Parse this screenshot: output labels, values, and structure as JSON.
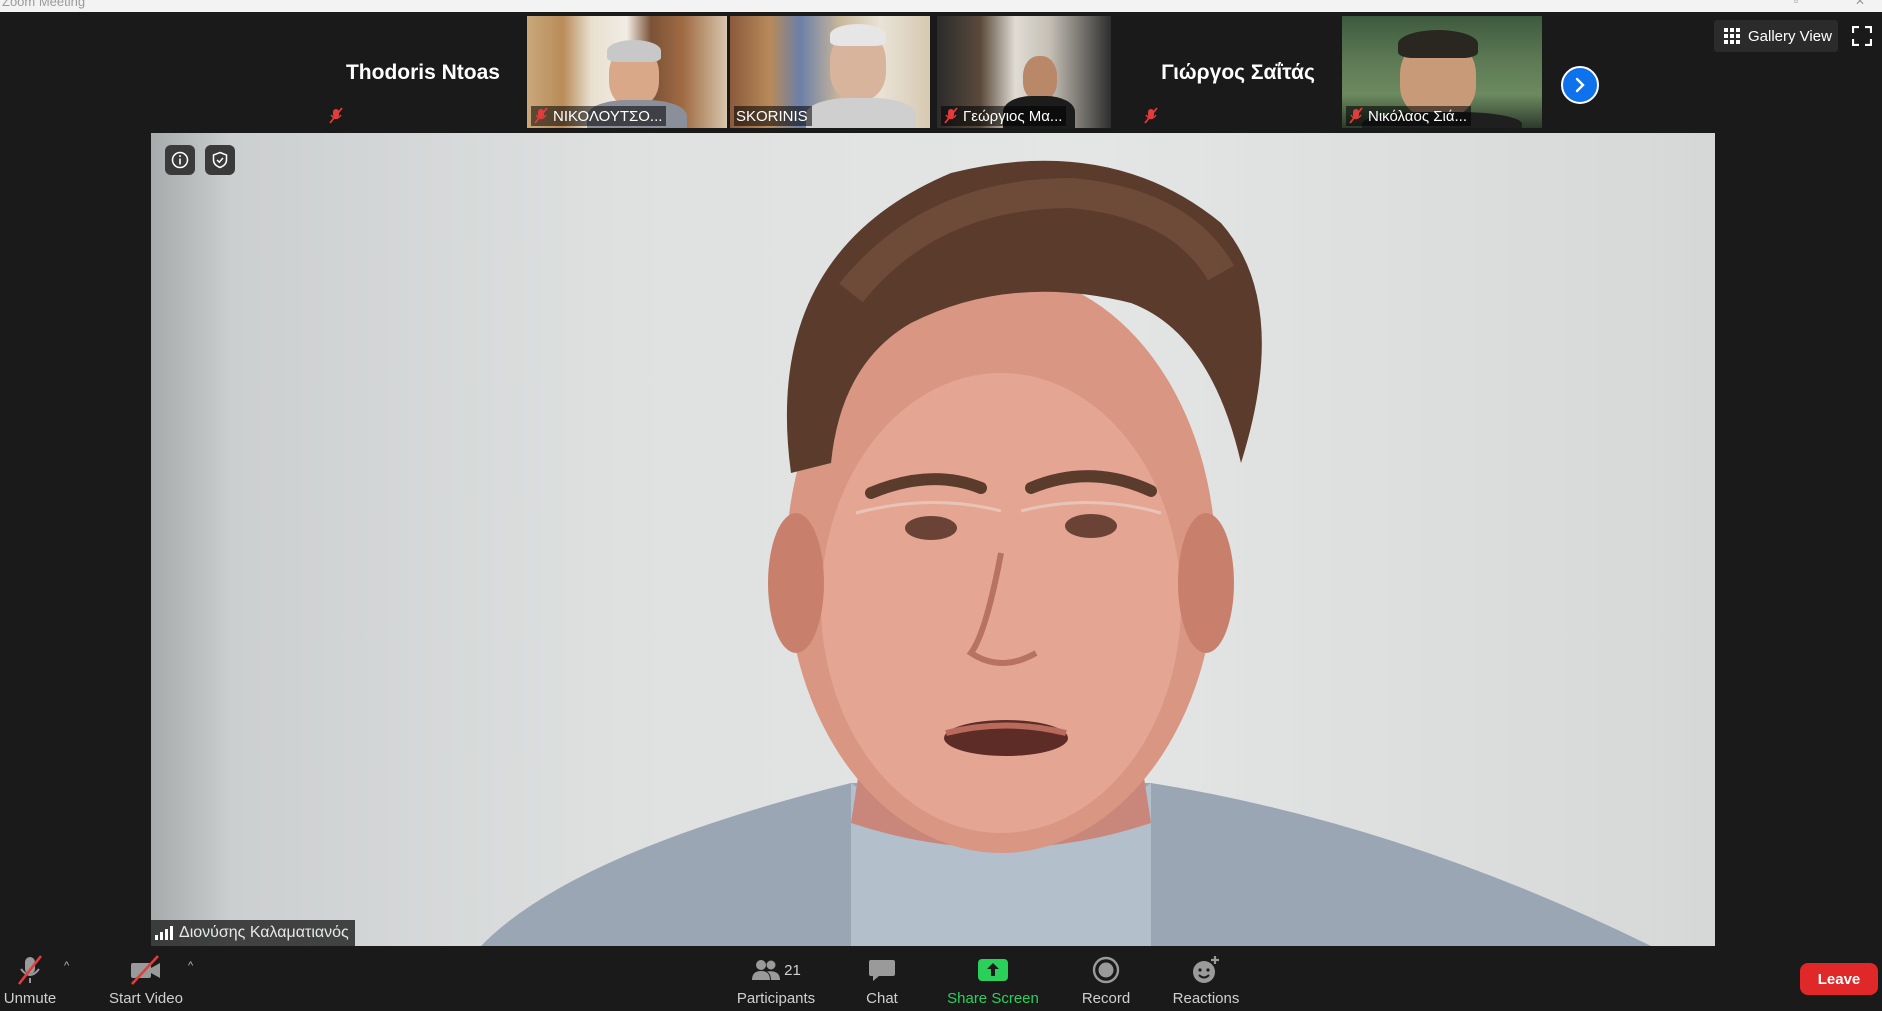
{
  "window": {
    "title": "Zoom Meeting"
  },
  "strip": {
    "tiles": [
      {
        "name": "Thodoris Ntoas",
        "muted": true,
        "video": false
      },
      {
        "name": "ΝΙΚΟΛΟΥΤΣΟ...",
        "muted": true,
        "video": true
      },
      {
        "name": "SKORINIS",
        "muted": false,
        "video": true
      },
      {
        "name": "Γεώργιος Μα...",
        "muted": true,
        "video": true
      },
      {
        "name": "Γιώργος Σαΐτάς",
        "muted": true,
        "video": false
      },
      {
        "name": "Νικόλαος Σιά...",
        "muted": true,
        "video": true
      }
    ],
    "next_icon": "chevron-right-icon"
  },
  "view": {
    "gallery_label": "Gallery View",
    "gallery_icon": "grid-icon",
    "fullscreen_icon": "fullscreen-icon"
  },
  "main": {
    "speaker_name": "Διονύσης Καλαματιανός",
    "info_icon": "info-icon",
    "shield_icon": "shield-icon",
    "signal_icon": "signal-bars-icon"
  },
  "toolbar": {
    "unmute_label": "Unmute",
    "start_video_label": "Start Video",
    "participants_label": "Participants",
    "participants_count": "21",
    "chat_label": "Chat",
    "share_screen_label": "Share Screen",
    "record_label": "Record",
    "reactions_label": "Reactions",
    "leave_label": "Leave"
  },
  "colors": {
    "share_green": "#2bd05b",
    "leave_red": "#e02828",
    "accent_blue": "#0e72ed",
    "mute_red": "#e23c3c"
  }
}
